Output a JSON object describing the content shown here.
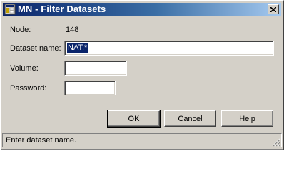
{
  "window": {
    "title": "MN - Filter Datasets"
  },
  "icons": {
    "app": "app-icon",
    "close": "close-icon",
    "grip": "resize-grip-icon"
  },
  "form": {
    "node_label": "Node:",
    "node_value": "148",
    "dataset_label": "Dataset name:",
    "dataset_value": "NAT.*",
    "volume_label": "Volume:",
    "volume_value": "",
    "password_label": "Password:",
    "password_value": ""
  },
  "buttons": {
    "ok": "OK",
    "cancel": "Cancel",
    "help": "Help"
  },
  "status": {
    "text": "Enter dataset name."
  },
  "colors": {
    "titlebar_start": "#0a246a",
    "titlebar_end": "#a6caf0",
    "face": "#d4d0c8",
    "selection": "#0a246a"
  }
}
